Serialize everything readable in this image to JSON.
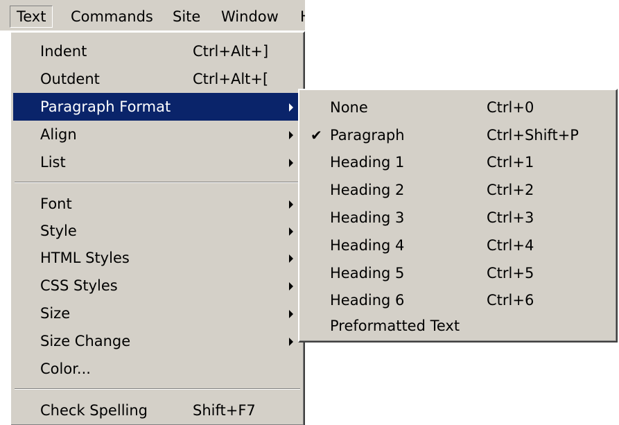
{
  "menubar": {
    "items": [
      {
        "label": "Text"
      },
      {
        "label": "Commands"
      },
      {
        "label": "Site"
      },
      {
        "label": "Window"
      },
      {
        "label": "H"
      }
    ]
  },
  "text_menu": {
    "items": [
      {
        "label": "Indent",
        "shortcut": "Ctrl+Alt+]"
      },
      {
        "label": "Outdent",
        "shortcut": "Ctrl+Alt+["
      },
      {
        "label": "Paragraph Format",
        "submenu": true,
        "highlighted": true
      },
      {
        "label": "Align",
        "submenu": true
      },
      {
        "label": "List",
        "submenu": true
      },
      {
        "label": "Font",
        "submenu": true
      },
      {
        "label": "Style",
        "submenu": true
      },
      {
        "label": "HTML Styles",
        "submenu": true
      },
      {
        "label": "CSS Styles",
        "submenu": true
      },
      {
        "label": "Size",
        "submenu": true
      },
      {
        "label": "Size Change",
        "submenu": true
      },
      {
        "label": "Color..."
      },
      {
        "label": "Check Spelling",
        "shortcut": "Shift+F7"
      }
    ]
  },
  "paragraph_format_submenu": {
    "checkmark": "✔",
    "items": [
      {
        "label": "None",
        "shortcut": "Ctrl+0"
      },
      {
        "label": "Paragraph",
        "shortcut": "Ctrl+Shift+P",
        "checked": true
      },
      {
        "label": "Heading 1",
        "shortcut": "Ctrl+1"
      },
      {
        "label": "Heading 2",
        "shortcut": "Ctrl+2"
      },
      {
        "label": "Heading 3",
        "shortcut": "Ctrl+3"
      },
      {
        "label": "Heading 4",
        "shortcut": "Ctrl+4"
      },
      {
        "label": "Heading 5",
        "shortcut": "Ctrl+5"
      },
      {
        "label": "Heading 6",
        "shortcut": "Ctrl+6"
      },
      {
        "label": "Preformatted Text",
        "shortcut": ""
      }
    ]
  },
  "colors": {
    "menu_face": "#d4d0c8",
    "highlight": "#0a246a",
    "highlight_text": "#ffffff"
  }
}
